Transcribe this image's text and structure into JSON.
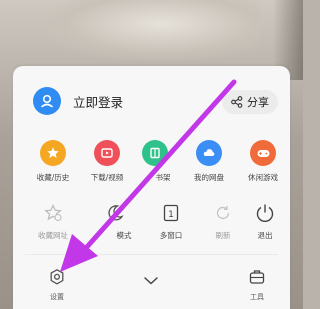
{
  "header": {
    "login_label": "立即登录",
    "share_label": "分享"
  },
  "row1": [
    {
      "label": "收藏/历史",
      "icon": "star-icon",
      "color": "#f5a623"
    },
    {
      "label": "下载/视频",
      "icon": "download-video-icon",
      "color": "#f0505a"
    },
    {
      "label": "书架",
      "icon": "bookshelf-icon",
      "color": "#2fc18a"
    },
    {
      "label": "我的网盘",
      "icon": "cloud-drive-icon",
      "color": "#3a8ef6"
    },
    {
      "label": "休闲游戏",
      "icon": "gamepad-icon",
      "color": "#f06a3a"
    }
  ],
  "row2": [
    {
      "label": "收藏网址",
      "icon": "bookmark-star-icon"
    },
    {
      "label": "模式",
      "icon": "night-mode-icon"
    },
    {
      "label": "多窗口",
      "icon": "multi-window-icon",
      "badge": "1"
    },
    {
      "label": "刷新",
      "icon": "refresh-icon"
    },
    {
      "label": "退出",
      "icon": "power-icon"
    }
  ],
  "bottom": {
    "settings_label": "设置",
    "toolbox_label": "工具"
  },
  "colors": {
    "accent": "#2f8cf2",
    "annotation_arrow": "#c238e8"
  }
}
